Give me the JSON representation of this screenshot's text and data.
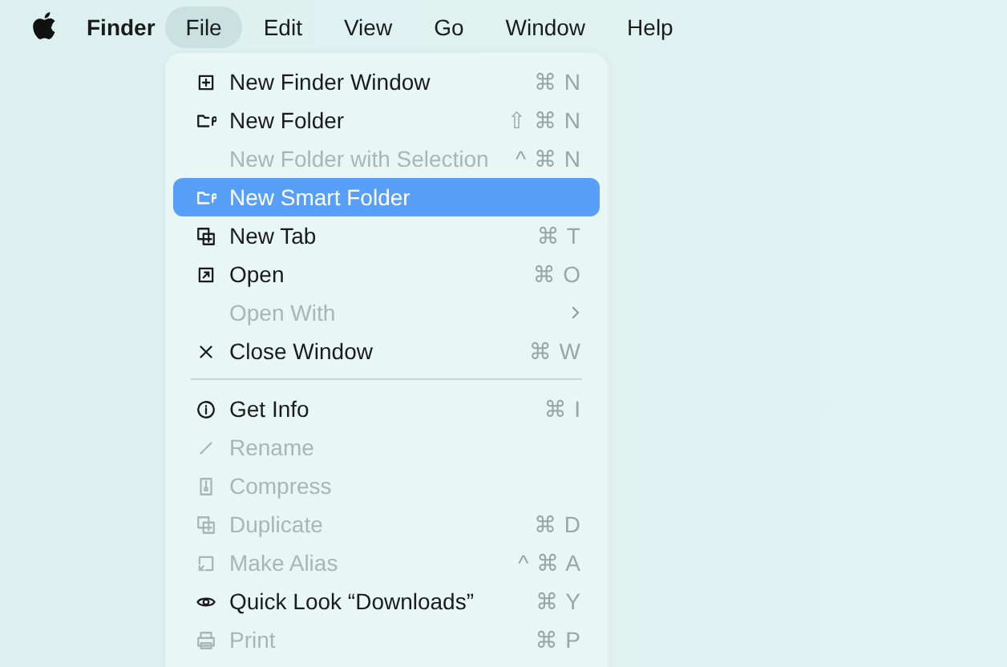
{
  "menubar": {
    "app": "Finder",
    "menus": [
      {
        "label": "File",
        "selected": true
      },
      {
        "label": "Edit",
        "selected": false
      },
      {
        "label": "View",
        "selected": false
      },
      {
        "label": "Go",
        "selected": false
      },
      {
        "label": "Window",
        "selected": false
      },
      {
        "label": "Help",
        "selected": false
      }
    ]
  },
  "menu": {
    "sections": [
      {
        "items": [
          {
            "label": "New Finder Window",
            "shortcut": "⌘ N",
            "disabled": false,
            "selected": false
          },
          {
            "label": "New Folder",
            "shortcut": "⇧ ⌘ N",
            "disabled": false,
            "selected": false
          },
          {
            "label": "New Folder with Selection",
            "shortcut": "^ ⌘ N",
            "disabled": true,
            "selected": false
          },
          {
            "label": "New Smart Folder",
            "disabled": false,
            "selected": true
          },
          {
            "label": "New Tab",
            "shortcut": "⌘ T",
            "disabled": false,
            "selected": false
          },
          {
            "label": "Open",
            "shortcut": "⌘ O",
            "disabled": false,
            "selected": false
          },
          {
            "label": "Open With",
            "submenu": true,
            "disabled": true,
            "selected": false
          },
          {
            "label": "Close Window",
            "shortcut": "⌘ W",
            "disabled": false,
            "selected": false
          }
        ]
      },
      {
        "items": [
          {
            "label": "Get Info",
            "shortcut": "⌘ I",
            "disabled": false,
            "selected": false
          },
          {
            "label": "Rename",
            "disabled": true,
            "selected": false
          },
          {
            "label": "Compress",
            "disabled": true,
            "selected": false
          },
          {
            "label": "Duplicate",
            "shortcut": "⌘ D",
            "disabled": true,
            "selected": false
          },
          {
            "label": "Make Alias",
            "shortcut": "^ ⌘ A",
            "disabled": true,
            "selected": false
          },
          {
            "label": "Quick Look “Downloads”",
            "shortcut": "⌘ Y",
            "disabled": false,
            "selected": false
          },
          {
            "label": "Print",
            "shortcut": "⌘ P",
            "disabled": true,
            "selected": false
          }
        ]
      }
    ]
  }
}
